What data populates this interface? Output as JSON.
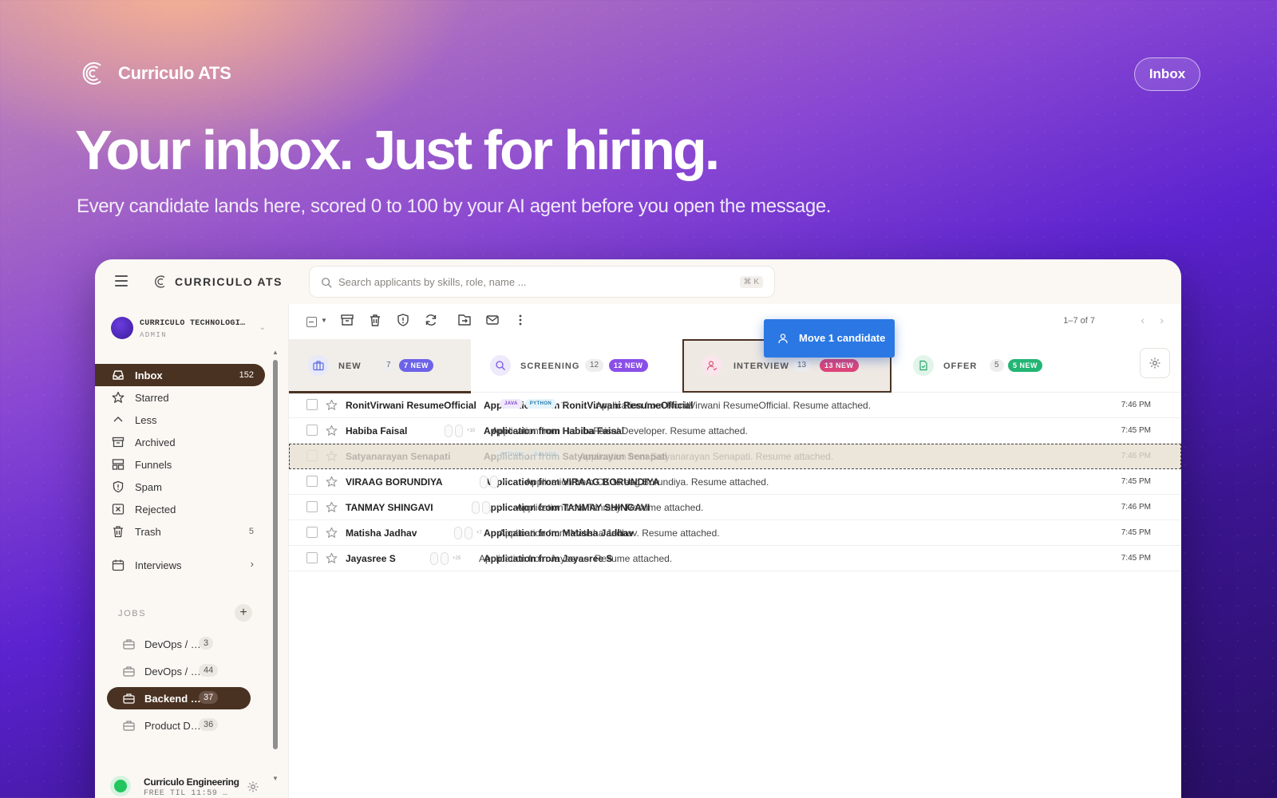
{
  "hero": {
    "brand": "Curriculo ATS",
    "nav_button": "Inbox",
    "title": "Your inbox. Just for hiring.",
    "subtitle": "Every candidate lands here, scored 0 to 100 by your AI agent before you open the message."
  },
  "app": {
    "name": "CURRICULO ATS",
    "search": {
      "placeholder": "Search applicants by skills, role, name ...",
      "shortcut": "⌘ K"
    }
  },
  "sidebar": {
    "org": {
      "name": "CURRICULO TECHNOLOGI…",
      "role": "ADMIN"
    },
    "items": [
      {
        "label": "Inbox",
        "count": "152",
        "icon": "inbox-icon",
        "active": true
      },
      {
        "label": "Starred",
        "count": "",
        "icon": "star-icon"
      },
      {
        "label": "Less",
        "count": "",
        "icon": "chevron-up-icon"
      },
      {
        "label": "Archived",
        "count": "",
        "icon": "archive-icon"
      },
      {
        "label": "Funnels",
        "count": "",
        "icon": "funnel-icon"
      },
      {
        "label": "Spam",
        "count": "",
        "icon": "shield-icon"
      },
      {
        "label": "Rejected",
        "count": "",
        "icon": "reject-icon"
      },
      {
        "label": "Trash",
        "count": "5",
        "icon": "trash-icon"
      },
      {
        "label": "Interviews",
        "count": "",
        "icon": "calendar-icon"
      }
    ],
    "jobs_title": "JOBS",
    "jobs": [
      {
        "label": "DevOps / S…",
        "count": "3"
      },
      {
        "label": "DevOps / …",
        "count": "44"
      },
      {
        "label": "Backend …",
        "count": "37",
        "active": true
      },
      {
        "label": "Product D…",
        "count": "36"
      }
    ],
    "workspace": {
      "name": "Curriculo Engineering",
      "plan": "FREE TIL 11:59 …"
    }
  },
  "toolbar": {
    "pager": "1–7 of 7",
    "tooltip": "Move 1 candidate"
  },
  "tabs": [
    {
      "label": "NEW",
      "count": "7",
      "new": "7 NEW",
      "accent": "#5b6ad8",
      "new_color": "#6c63e8"
    },
    {
      "label": "SCREENING",
      "count": "12",
      "new": "12 NEW",
      "accent": "#7a5ae0",
      "new_color": "#8a4fe8"
    },
    {
      "label": "INTERVIEW",
      "count": "13",
      "new": "13 NEW",
      "accent": "#d9587c",
      "new_color": "#e0457a"
    },
    {
      "label": "OFFER",
      "count": "5",
      "new": "5 NEW",
      "accent": "#23a868",
      "new_color": "#22b573"
    }
  ],
  "rows": [
    {
      "sender": "RonitVirwani ResumeOfficial",
      "subject": "Application from RonitVirwani ResumeOfficial",
      "tags": [
        "JAVA",
        "PYTHON"
      ],
      "more": "+13",
      "snippet": "Application from RonitVirwani ResumeOfficial. Resume attached.",
      "time": "7:46 PM"
    },
    {
      "sender": "Habiba Faisal",
      "subject": "Application from Habiba Faisal",
      "more": "+10",
      "snippet": "Application from HabibaFaisal Developer. Resume attached.",
      "time": "7:45 PM"
    },
    {
      "sender": "Satyanarayan Senapati",
      "subject": "Application from Satyanarayan Senapati",
      "tags": [
        "PYTHON",
        "DJANGO"
      ],
      "more": "",
      "snippet": "Application from Satyanarayan Senapati. Resume attached.",
      "time": "7:46 PM",
      "dragged": true
    },
    {
      "sender": "VIRAAG BORUNDIYA",
      "subject": "Application from VIRAAG BORUNDIYA",
      "more": "+3",
      "snippet": "Application from CK Viraag Borundiya. Resume attached.",
      "time": "7:45 PM"
    },
    {
      "sender": "TANMAY SHINGAVI",
      "subject": "Application from TANMAY SHINGAVI",
      "more": "+1",
      "snippet": "Application from Tanmay. Resume attached.",
      "time": "7:46 PM"
    },
    {
      "sender": "Matisha Jadhav",
      "subject": "Application from Matisha Jadhav",
      "more": "+7",
      "snippet": "Application from Matisha Jadhav. Resume attached.",
      "time": "7:45 PM"
    },
    {
      "sender": "Jayasree S",
      "subject": "Application from Jayasree S",
      "more": "+25",
      "snippet": "Application from Jayasree. Resume attached.",
      "time": "7:45 PM"
    }
  ]
}
